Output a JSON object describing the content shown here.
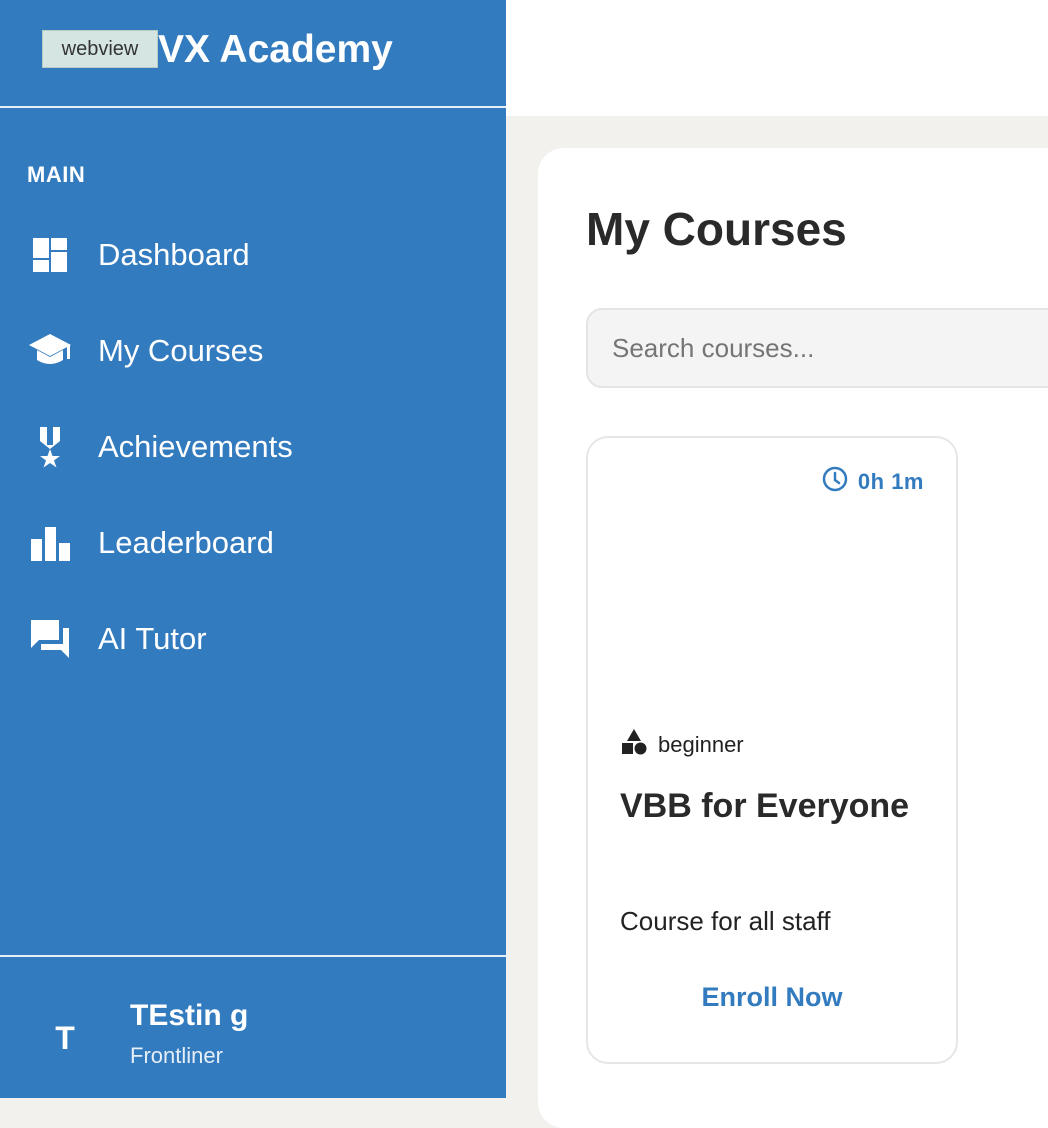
{
  "app": {
    "title": "VX Academy",
    "webview_tag": "webview",
    "accent_color": "#337bbf"
  },
  "sidebar": {
    "section_label": "MAIN",
    "items": [
      {
        "label": "Dashboard",
        "icon": "dashboard-icon"
      },
      {
        "label": "My Courses",
        "icon": "graduation-cap-icon"
      },
      {
        "label": "Achievements",
        "icon": "medal-icon"
      },
      {
        "label": "Leaderboard",
        "icon": "bar-chart-icon"
      },
      {
        "label": "AI Tutor",
        "icon": "chat-icon"
      }
    ],
    "user": {
      "initial": "T",
      "name": "TEstin g",
      "role": "Frontliner"
    }
  },
  "main": {
    "title": "My Courses",
    "search_placeholder": "Search courses...",
    "courses": [
      {
        "duration": "0h 1m",
        "level": "beginner",
        "title": "VBB for Everyone",
        "description": "Course for all staff",
        "action": "Enroll Now"
      }
    ]
  }
}
